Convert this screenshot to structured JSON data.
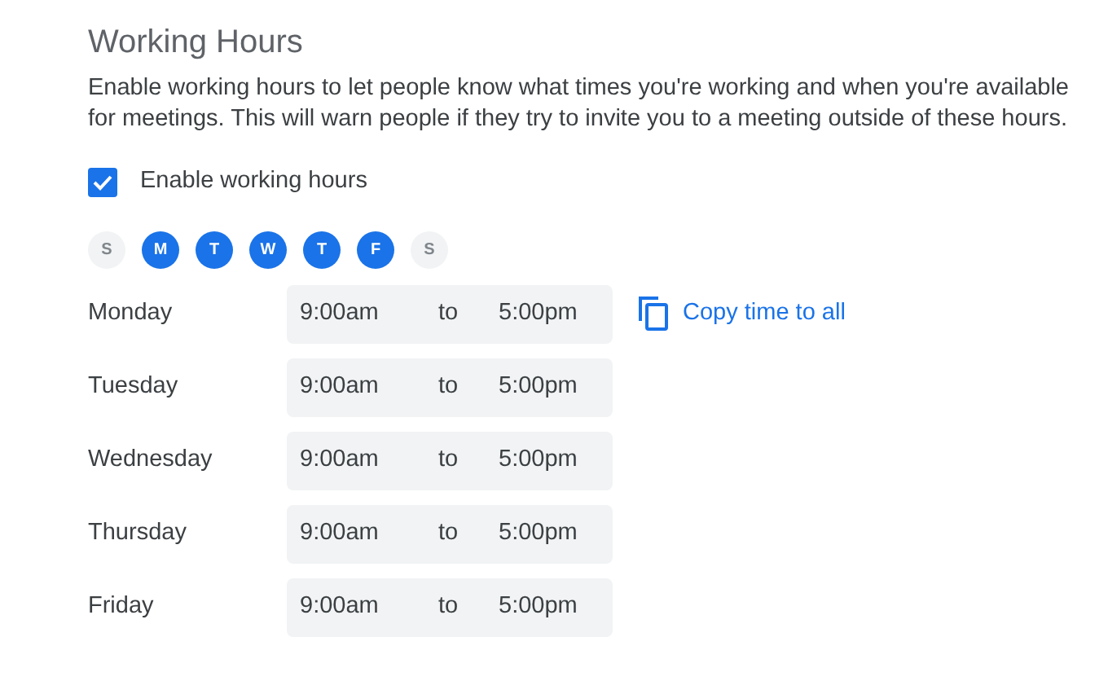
{
  "title": "Working Hours",
  "description": "Enable working hours to let people know what times you're working and when you're available for meetings. This will warn people if they try to invite you to a meeting outside of these hours.",
  "enable": {
    "label": "Enable working hours",
    "checked": true
  },
  "days": [
    {
      "label": "S",
      "selected": false
    },
    {
      "label": "M",
      "selected": true
    },
    {
      "label": "T",
      "selected": true
    },
    {
      "label": "W",
      "selected": true
    },
    {
      "label": "T",
      "selected": true
    },
    {
      "label": "F",
      "selected": true
    },
    {
      "label": "S",
      "selected": false
    }
  ],
  "rows": [
    {
      "day": "Monday",
      "start": "9:00am",
      "separator": "to",
      "end": "5:00pm"
    },
    {
      "day": "Tuesday",
      "start": "9:00am",
      "separator": "to",
      "end": "5:00pm"
    },
    {
      "day": "Wednesday",
      "start": "9:00am",
      "separator": "to",
      "end": "5:00pm"
    },
    {
      "day": "Thursday",
      "start": "9:00am",
      "separator": "to",
      "end": "5:00pm"
    },
    {
      "day": "Friday",
      "start": "9:00am",
      "separator": "to",
      "end": "5:00pm"
    }
  ],
  "copy_action": {
    "label": "Copy time to all"
  }
}
